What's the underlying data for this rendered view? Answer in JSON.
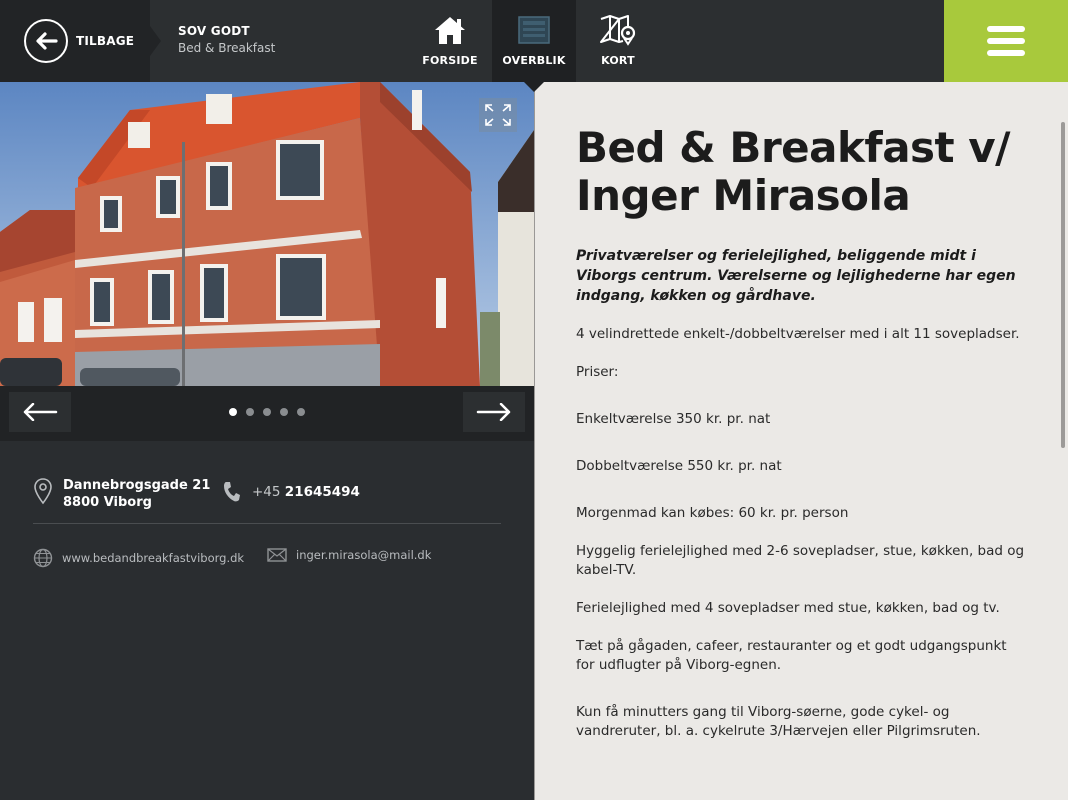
{
  "header": {
    "back_label": "TILBAGE",
    "crumb_title": "SOV GODT",
    "crumb_subtitle": "Bed & Breakfast",
    "tabs": [
      {
        "label": "FORSIDE",
        "icon": "home-icon"
      },
      {
        "label": "OVERBLIK",
        "icon": "overview-icon",
        "active": true
      },
      {
        "label": "KORT",
        "icon": "map-icon"
      }
    ],
    "accent_color": "#a8c93c"
  },
  "gallery": {
    "total_images": 5,
    "active_index": 0
  },
  "contact": {
    "address_line1": "Dannebrogsgade 21",
    "address_line2": "8800 Viborg",
    "phone_prefix": "+45",
    "phone_number": "21645494",
    "website": "www.bedandbreakfastviborg.dk",
    "email": "inger.mirasola@mail.dk"
  },
  "article": {
    "title": "Bed & Breakfast v/ Inger Mirasola",
    "lead": "Privatværelser og ferielejlighed, beliggende midt i Viborgs centrum. Værelserne og lejlighederne har egen indgang, køkken og gårdhave.",
    "paragraphs": [
      "4 velindrettede enkelt-/dobbeltværelser med i alt 11 sovepladser.",
      "Priser:",
      "Enkeltværelse 350 kr. pr. nat",
      "Dobbeltværelse 550 kr. pr. nat",
      "Morgenmad kan købes: 60 kr. pr. person",
      "Hyggelig ferielejlighed med 2-6 sovepladser,  stue, køkken, bad og kabel-TV.",
      "Ferielejlighed med 4 sovepladser med stue, køkken, bad og tv.",
      "Tæt på gågaden, cafeer, restauranter og et godt udgangspunkt for udflugter på Viborg-egnen.",
      "Kun få minutters gang til Viborg-søerne, gode cykel- og vandreruter, bl. a. cykelrute 3/Hærvejen eller Pilgrimsruten."
    ]
  }
}
